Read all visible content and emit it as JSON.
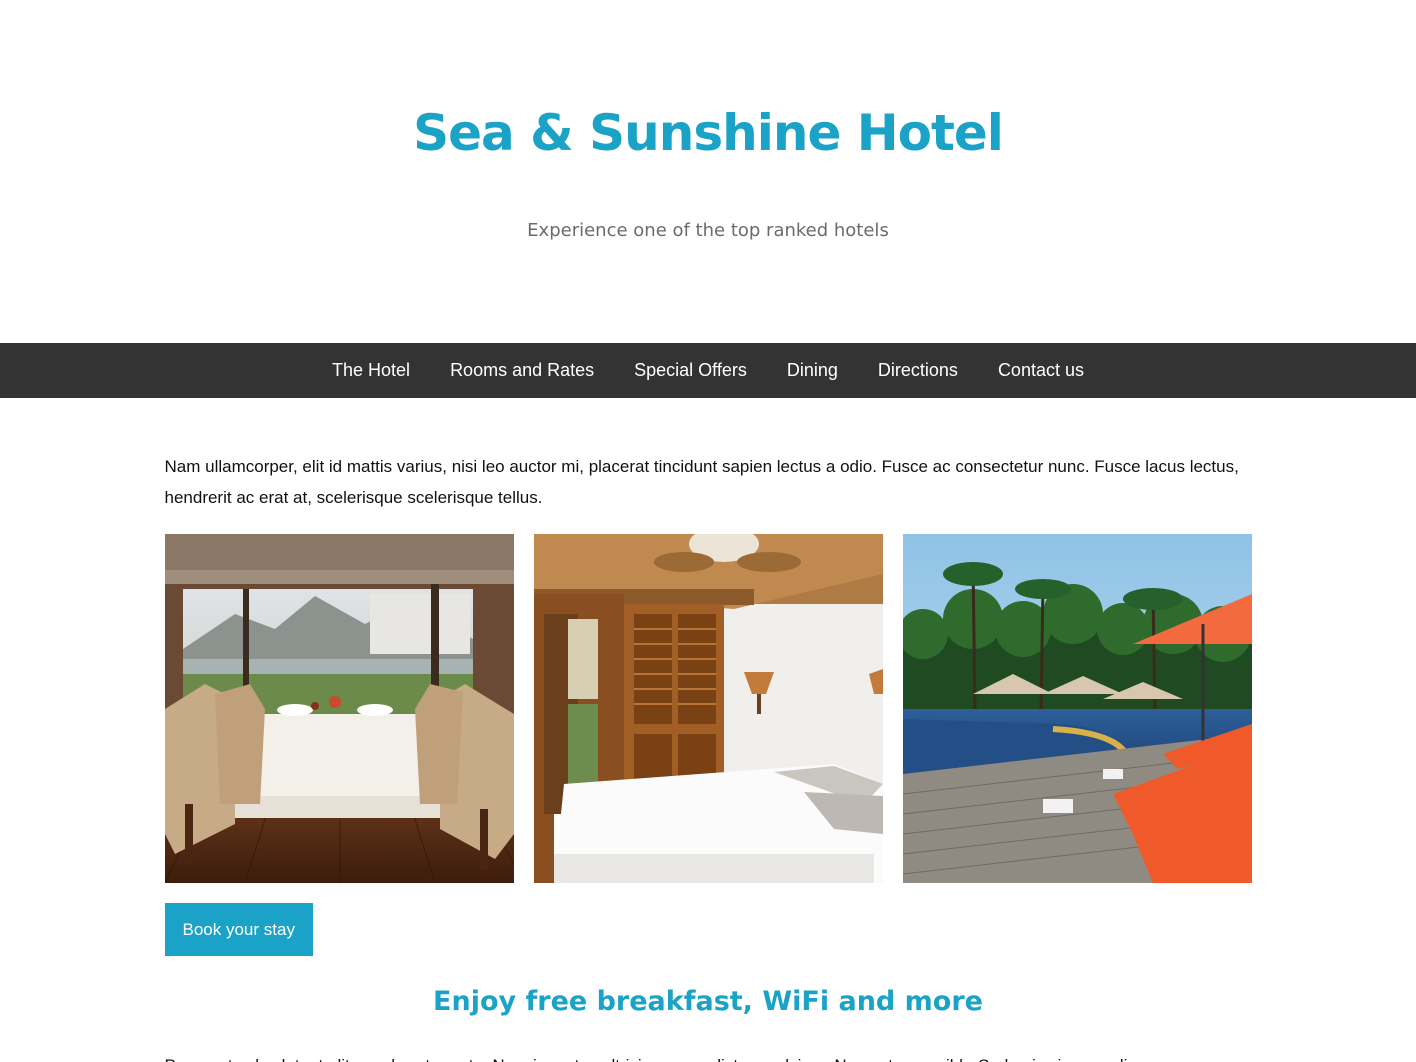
{
  "header": {
    "title": "Sea & Sunshine Hotel",
    "tagline": "Experience one of the top ranked hotels"
  },
  "nav": {
    "items": [
      {
        "label": "The Hotel"
      },
      {
        "label": "Rooms and Rates"
      },
      {
        "label": "Special Offers"
      },
      {
        "label": "Dining"
      },
      {
        "label": "Directions"
      },
      {
        "label": "Contact us"
      }
    ]
  },
  "main": {
    "intro": "Nam ullamcorper, elit id mattis varius, nisi leo auctor mi, placerat tincidunt sapien lectus a odio. Fusce ac consectetur nunc. Fusce lacus lectus, hendrerit ac erat at, scelerisque scelerisque tellus.",
    "book_button": "Book your stay",
    "subheading": "Enjoy free breakfast, WiFi and more",
    "body_text": "Praesent vel volutpat elit, ac pharetra ante. Nam in metus ultricies purus dictum pulvinar. Nunc ut urna nibh. Sed quis viverra odio, ac"
  },
  "colors": {
    "accent": "#1aa3c6",
    "nav_background": "#333333",
    "tagline": "#6b6b6b"
  }
}
